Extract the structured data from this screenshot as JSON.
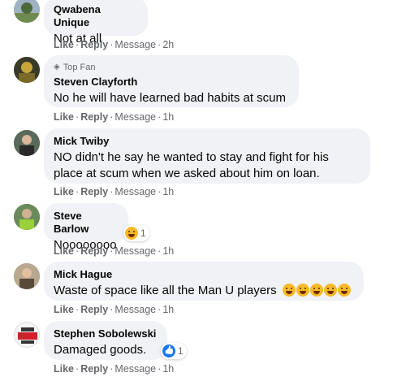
{
  "comments": [
    {
      "author": "Qwabena Unique",
      "text": "Not at all",
      "actions": {
        "like": "Like",
        "reply": "Reply",
        "message": "Message",
        "time": "2h"
      }
    },
    {
      "badge": "Top Fan",
      "author": "Steven Clayforth",
      "text": "No he will have learned bad habits at scum",
      "actions": {
        "like": "Like",
        "reply": "Reply",
        "message": "Message",
        "time": "1h"
      }
    },
    {
      "author": "Mick Twiby",
      "text_line1": "NO didn't he say he wanted to stay and fight for his",
      "text_line2": "place at scum when we asked about him on loan.",
      "actions": {
        "like": "Like",
        "reply": "Reply",
        "message": "Message",
        "time": "1h"
      }
    },
    {
      "author": "Steve Barlow",
      "text": "Noooooooo",
      "reaction": {
        "type": "haha",
        "count": "1"
      },
      "actions": {
        "like": "Like",
        "reply": "Reply",
        "message": "Message",
        "time": "1h"
      }
    },
    {
      "author": "Mick Hague",
      "text": "Waste of space like all the Man U players",
      "emoji_count": 5,
      "actions": {
        "like": "Like",
        "reply": "Reply",
        "message": "Message",
        "time": "1h"
      }
    },
    {
      "author": "Stephen Sobolewski",
      "text": "Damaged goods.",
      "reaction": {
        "type": "like",
        "count": "1"
      },
      "actions": {
        "like": "Like",
        "reply": "Reply",
        "message": "Message",
        "time": "1h"
      }
    }
  ],
  "colors": {
    "bubble": "#f0f2f5",
    "secondary_text": "#65676b",
    "like_blue": "#1877f2",
    "haha_yellow": "#f7b928"
  }
}
